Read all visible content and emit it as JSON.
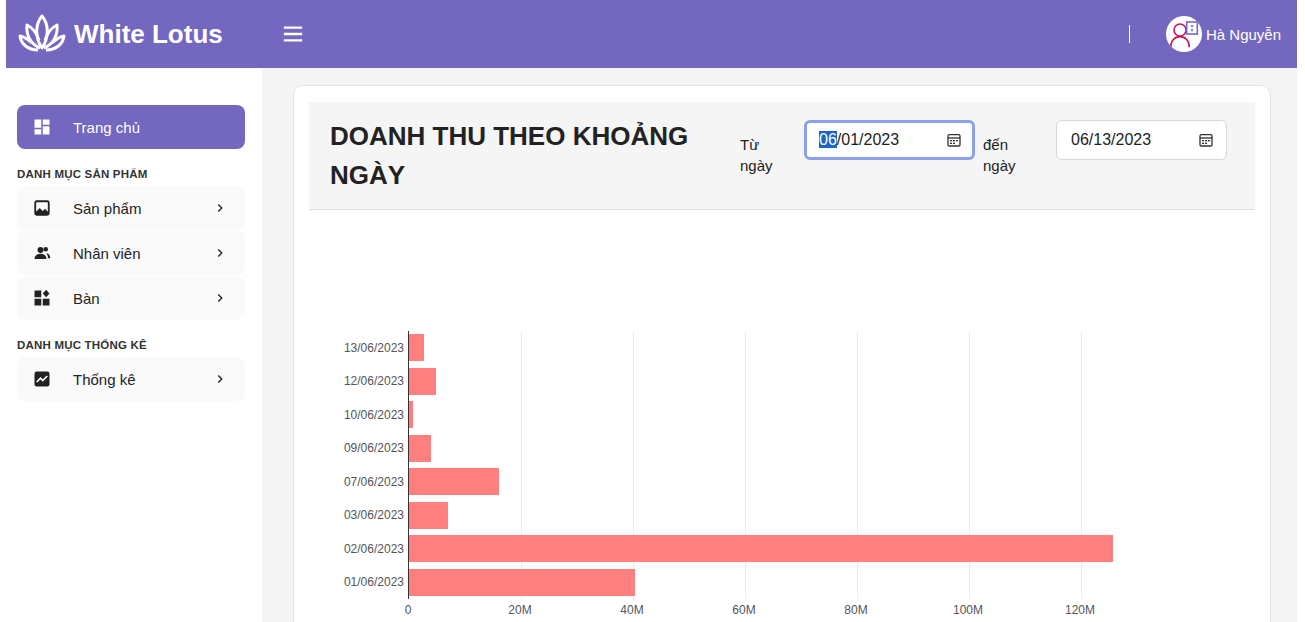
{
  "header": {
    "brand": "White Lotus",
    "user": "Hà Nguyễn"
  },
  "sidebar": {
    "home": {
      "label": "Trang chủ",
      "selected": true
    },
    "sections": [
      {
        "title": "DANH MỤC SẢN PHẨM",
        "items": [
          {
            "label": "Sản phẩm",
            "selected": false
          },
          {
            "label": "Nhân viên",
            "selected": false
          },
          {
            "label": "Bàn",
            "selected": false
          }
        ]
      },
      {
        "title": "DANH MỤC THỐNG KÊ",
        "items": [
          {
            "label": "Thống kê",
            "selected": false
          }
        ]
      }
    ]
  },
  "card": {
    "title": "DOANH THU THEO KHOẢNG NGÀY",
    "from": {
      "label": "Từ ngày",
      "selected_part": "06",
      "rest": "/01/2023",
      "focused": true
    },
    "to": {
      "label": "đến ngày",
      "value": "06/13/2023",
      "focused": false
    }
  },
  "chart": {
    "labels": [
      "13/06/2023",
      "12/06/2023",
      "10/06/2023",
      "09/06/2023",
      "07/06/2023",
      "03/06/2023",
      "02/06/2023",
      "01/06/2023"
    ],
    "values": [
      2700000,
      4800000,
      700000,
      3900000,
      16000000,
      7000000,
      125700000,
      40400000
    ],
    "ticks": [
      "0",
      "20M",
      "40M",
      "60M",
      "80M",
      "100M",
      "120M"
    ]
  }
}
